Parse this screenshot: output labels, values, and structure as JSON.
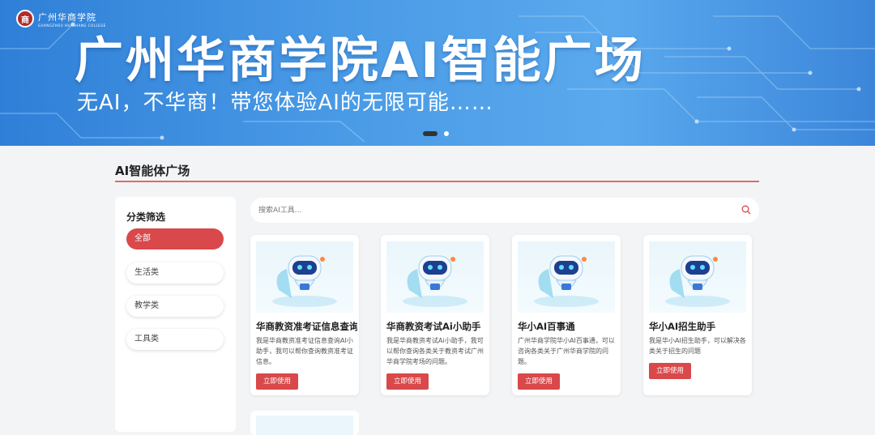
{
  "header": {
    "logo_cn": "广州华商学院",
    "logo_en": "GUANGZHOU HUASHANG COLLEGE",
    "title": "广州华商学院AI智能广场",
    "subtitle": "无AI，不华商！带您体验AI的无限可能……"
  },
  "section": {
    "title": "AI智能体广场"
  },
  "filter": {
    "title": "分类筛选",
    "items": [
      {
        "label": "全部",
        "active": true
      },
      {
        "label": "生活类",
        "active": false
      },
      {
        "label": "教学类",
        "active": false
      },
      {
        "label": "工具类",
        "active": false
      }
    ]
  },
  "search": {
    "placeholder": "搜索AI工具..."
  },
  "cards": [
    {
      "title": "华商教资准考证信息查询",
      "desc": "我是华商教资准考证信息查询AI小助手，我可以帮你查询教资准考证信息。",
      "button": "立即使用"
    },
    {
      "title": "华商教资考试Ai小助手",
      "desc": "我是华商教资考试Ai小助手，我可以帮你查询各类关于教资考试广州华商学院考场的问题。",
      "button": "立即使用"
    },
    {
      "title": "华小AI百事通",
      "desc": "广州华商学院华小AI百事通，可以咨询各类关于广州华商学院的问题。",
      "button": "立即使用"
    },
    {
      "title": "华小AI招生助手",
      "desc": "我是华小AI招生助手，可以解决各类关于招生的问题",
      "button": "立即使用"
    }
  ],
  "colors": {
    "accent": "#d9484a",
    "banner": "#4a9be6"
  }
}
